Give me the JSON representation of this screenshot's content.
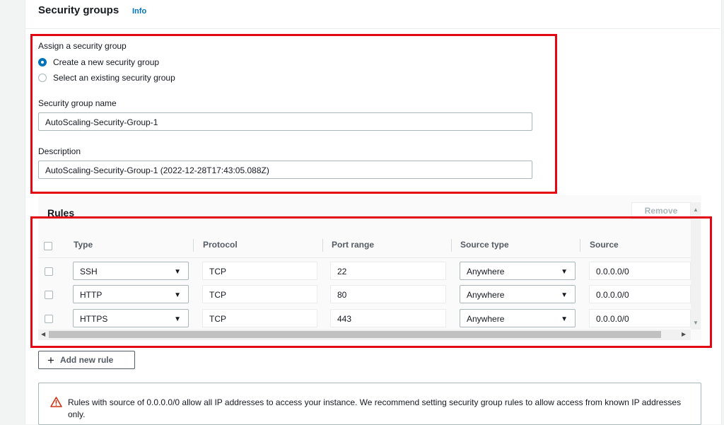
{
  "section": {
    "title": "Security groups",
    "info_link": "Info"
  },
  "assign": {
    "label": "Assign a security group",
    "options": [
      "Create a new security group",
      "Select an existing security group"
    ],
    "selected_index": 0
  },
  "name_field": {
    "label": "Security group name",
    "value": "AutoScaling-Security-Group-1"
  },
  "description_field": {
    "label": "Description",
    "value": "AutoScaling-Security-Group-1 (2022-12-28T17:43:05.088Z)"
  },
  "rules": {
    "title": "Rules",
    "remove_label": "Remove",
    "columns": [
      "Type",
      "Protocol",
      "Port range",
      "Source type",
      "Source"
    ],
    "rows": [
      {
        "type": "SSH",
        "protocol": "TCP",
        "port": "22",
        "source_type": "Anywhere",
        "source": "0.0.0.0/0"
      },
      {
        "type": "HTTP",
        "protocol": "TCP",
        "port": "80",
        "source_type": "Anywhere",
        "source": "0.0.0.0/0"
      },
      {
        "type": "HTTPS",
        "protocol": "TCP",
        "port": "443",
        "source_type": "Anywhere",
        "source": "0.0.0.0/0"
      }
    ],
    "add_label": "Add new rule"
  },
  "warning": {
    "text": "Rules with source of 0.0.0.0/0 allow all IP addresses to access your instance. We recommend setting security group rules to allow access from known IP addresses only."
  },
  "colors": {
    "accent": "#0073bb",
    "highlight": "#e30613",
    "warning": "#d13212"
  }
}
